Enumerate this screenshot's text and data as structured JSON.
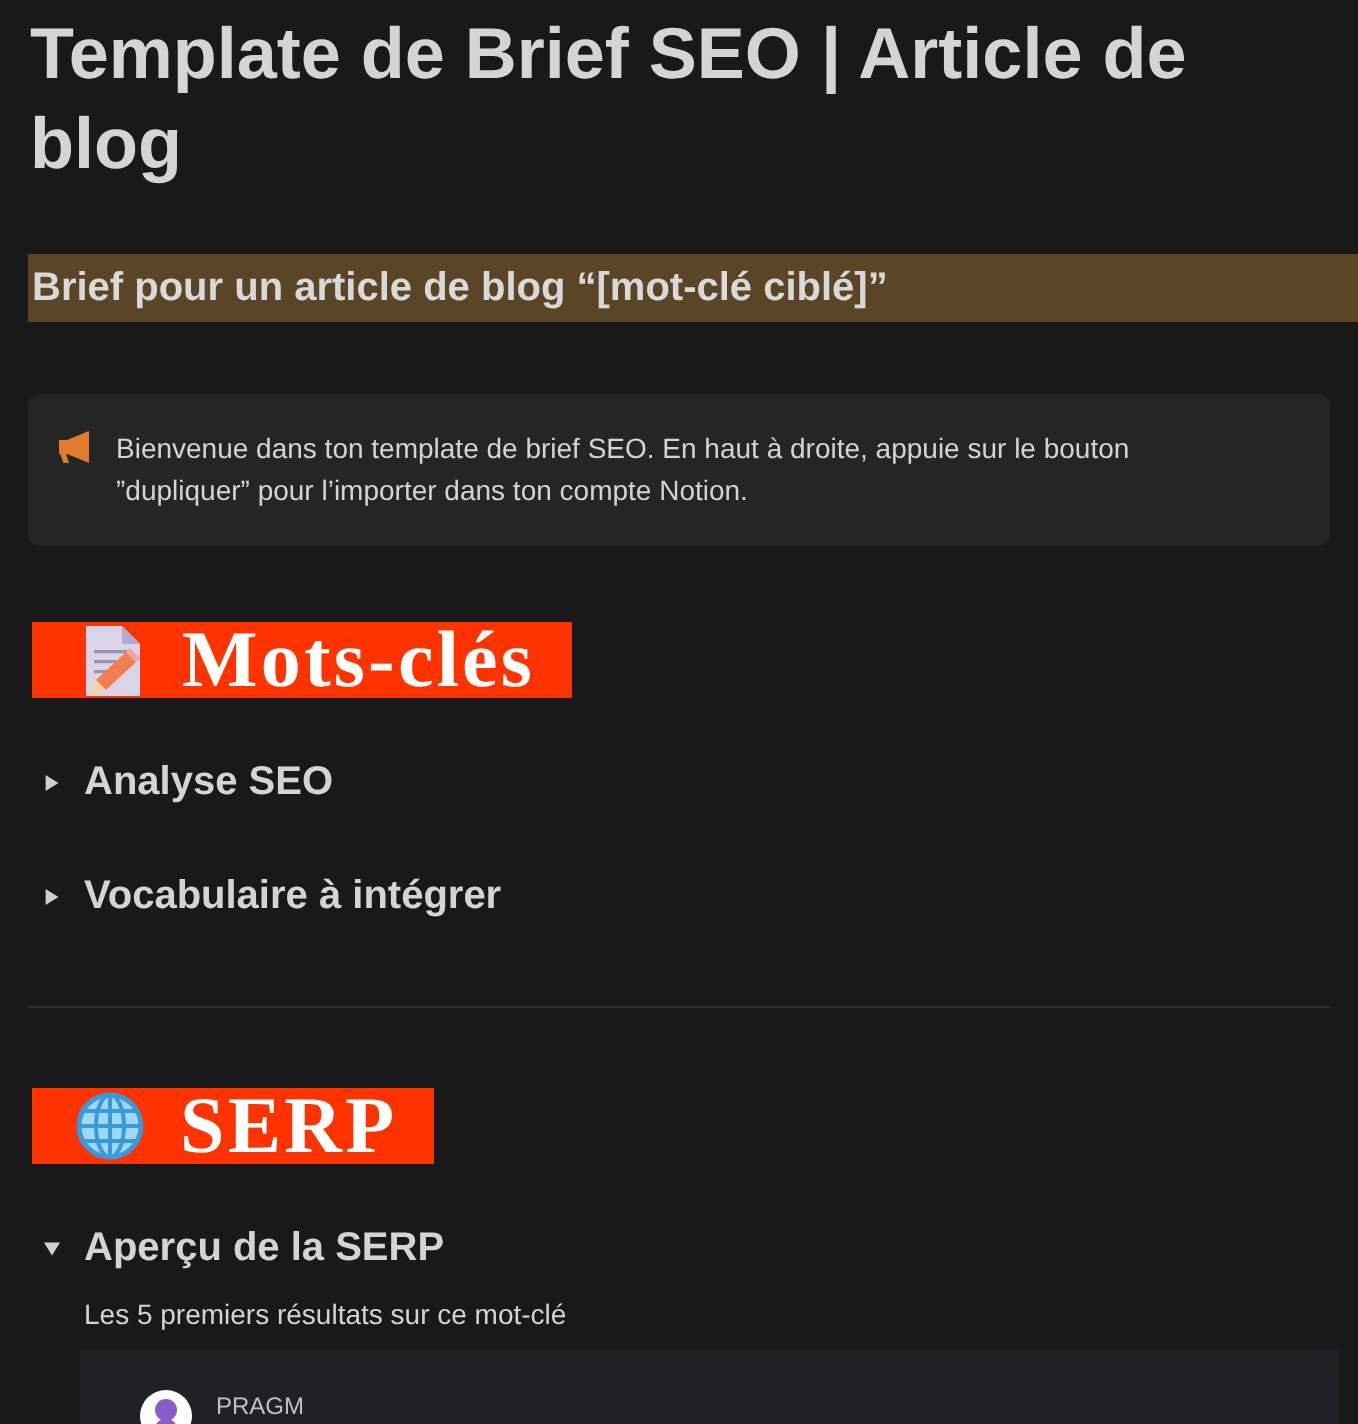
{
  "title": "Template de Brief SEO | Article de blog",
  "subtitle": "Brief pour un article de blog “[mot-clé ciblé]”",
  "callout": {
    "text": "Bienvenue dans ton template de brief SEO. En haut à droite, appuie sur le bouton ”dupliquer” pour l’importer dans ton compte Notion."
  },
  "sections": [
    {
      "heading": "Mots-clés",
      "toggles": [
        {
          "label": "Analyse SEO",
          "expanded": false
        },
        {
          "label": "Vocabulaire à intégrer",
          "expanded": false
        }
      ]
    },
    {
      "heading": "SERP",
      "toggles": [
        {
          "label": "Aperçu de la SERP",
          "expanded": true,
          "description": "Les 5 premiers résultats sur ce mot-clé",
          "results": [
            {
              "site": "PRAGM"
            }
          ]
        }
      ]
    }
  ]
}
